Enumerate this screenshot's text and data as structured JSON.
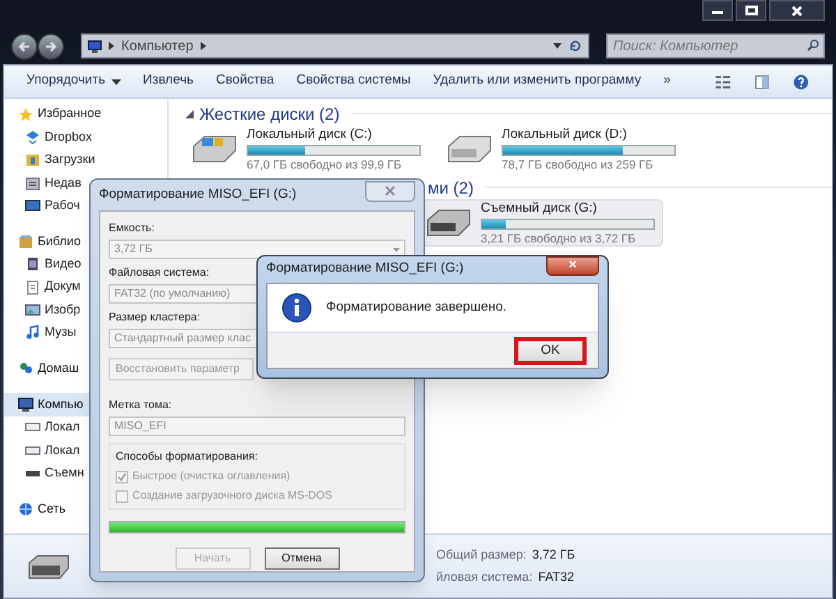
{
  "explorer": {
    "address": "Компьютер",
    "search": {
      "placeholder": "Поиск: Компьютер"
    },
    "toolbar": [
      "Упорядочить",
      "Извлечь",
      "Свойства",
      "Свойства системы",
      "Удалить или изменить программу",
      "»"
    ],
    "sidebar": [
      {
        "label": "Избранное",
        "kind": "star",
        "selected": false,
        "children": [
          {
            "label": "Dropbox",
            "kind": "dropbox",
            "selected": false
          },
          {
            "label": "Загрузки",
            "kind": "folder",
            "selected": false
          },
          {
            "label": "Недав",
            "kind": "recent",
            "selected": false
          },
          {
            "label": "Рабоч",
            "kind": "desktop",
            "selected": false
          }
        ]
      },
      {
        "label": "Библио",
        "kind": "library",
        "selected": false,
        "children": [
          {
            "label": "Видео",
            "kind": "video",
            "selected": false
          },
          {
            "label": "Докум",
            "kind": "doc",
            "selected": false
          },
          {
            "label": "Изобр",
            "kind": "image",
            "selected": false
          },
          {
            "label": "Музы",
            "kind": "music",
            "selected": false
          }
        ]
      },
      {
        "label": "Домаш",
        "kind": "homegroup",
        "selected": false
      },
      {
        "label": "Компью",
        "kind": "computer",
        "selected": true,
        "children": [
          {
            "label": "Локал",
            "kind": "drive",
            "selected": false
          },
          {
            "label": "Локал",
            "kind": "drive",
            "selected": false
          },
          {
            "label": "Съемн",
            "kind": "usb",
            "selected": false
          }
        ]
      },
      {
        "label": "Сеть",
        "kind": "network",
        "selected": false
      }
    ],
    "groups": [
      {
        "title": "Жесткие диски (2)",
        "drives": [
          {
            "name": "Локальный диск (C:)",
            "kind": "system",
            "level": 0.33,
            "free": "67,0 ГБ свободно из 99,9 ГБ",
            "selected": false
          },
          {
            "name": "Локальный диск (D:)",
            "kind": "disk",
            "level": 0.7,
            "free": "78,7 ГБ свободно из 259 ГБ",
            "selected": false
          }
        ]
      },
      {
        "title": "ми (2)",
        "drives": [
          {
            "name": "Съемный диск (G:)",
            "kind": "usb",
            "level": 0.14,
            "free": "3,21 ГБ свободно из 3,72 ГБ",
            "selected": true
          }
        ]
      }
    ],
    "details": [
      {
        "label": "Общий размер:",
        "value": "3,72 ГБ"
      },
      {
        "label": "йловая система:",
        "value": "FAT32"
      }
    ]
  },
  "format_dialog": {
    "title": "Форматирование MISO_EFI (G:)",
    "capacity_label": "Емкость:",
    "capacity": "3,72 ГБ",
    "fs_label": "Файловая система:",
    "fs": "FAT32 (по умолчанию)",
    "cluster_label": "Размер кластера:",
    "cluster": "Стандартный размер клас",
    "restore": "Восстановить параметр",
    "volume_label": "Метка тома:",
    "volume": "MISO_EFI",
    "options_label": "Способы форматирования:",
    "options": [
      {
        "label": "Быстрое (очистка оглавления)",
        "checked": true,
        "disabled": true
      },
      {
        "label": "Создание загрузочного диска MS-DOS",
        "checked": false,
        "disabled": true
      }
    ],
    "progress": {
      "level": 1
    },
    "buttons": [
      {
        "label": "Начать",
        "disabled": true
      },
      {
        "label": "Отмена",
        "disabled": false
      }
    ]
  },
  "message_box": {
    "title": "Форматирование MISO_EFI (G:)",
    "close": "×",
    "message": "Форматирование завершено.",
    "button": {
      "label": "OK",
      "highlighted": true
    }
  }
}
